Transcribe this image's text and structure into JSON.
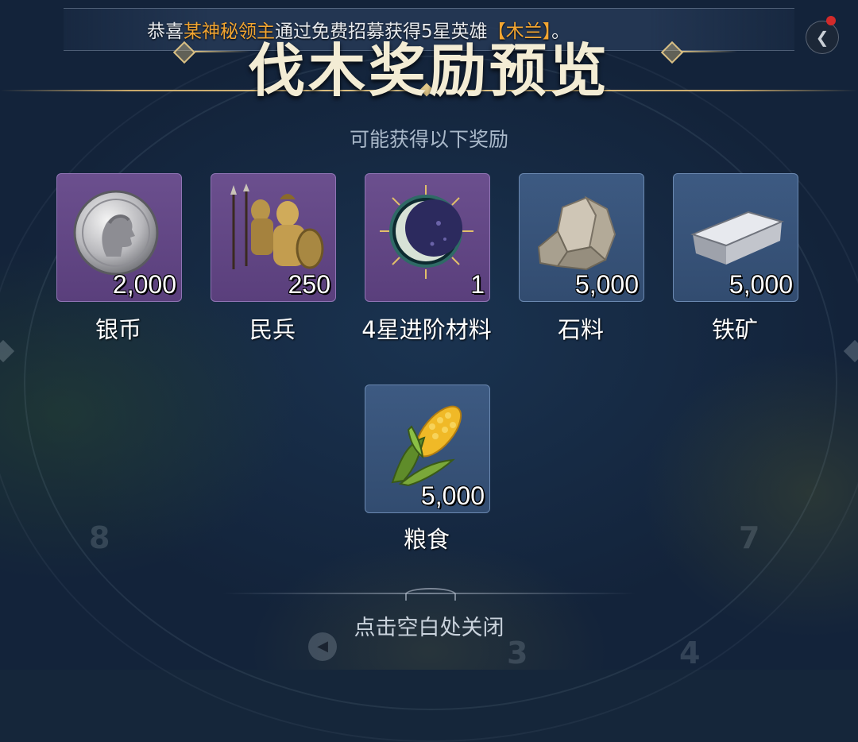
{
  "announcement": {
    "prefix": "恭喜",
    "player": "某神秘领主",
    "middle": "通过免费招募获得5星英雄",
    "hero": "【木兰】",
    "suffix": "。"
  },
  "title": "伐木奖励预览",
  "subtitle": "可能获得以下奖励",
  "rewards": [
    {
      "name": "银币",
      "count": "2,000",
      "icon": "silver-coin-icon",
      "rarity": "purple"
    },
    {
      "name": "民兵",
      "count": "250",
      "icon": "militia-soldiers-icon",
      "rarity": "purple"
    },
    {
      "name": "4星进阶材料",
      "count": "1",
      "icon": "moon-orb-icon",
      "rarity": "purple"
    },
    {
      "name": "石料",
      "count": "5,000",
      "icon": "stone-icon",
      "rarity": "blue"
    },
    {
      "name": "铁矿",
      "count": "5,000",
      "icon": "iron-ingot-icon",
      "rarity": "blue"
    },
    {
      "name": "粮食",
      "count": "5,000",
      "icon": "corn-icon",
      "rarity": "blue"
    }
  ],
  "close_hint": "点击空白处关闭",
  "map_numbers": [
    "8",
    "7",
    "3",
    "4"
  ],
  "colors": {
    "highlight": "#f2a531",
    "purple_card": "#5a3f7c",
    "blue_card": "#324c70",
    "title": "#f3ecd4"
  }
}
